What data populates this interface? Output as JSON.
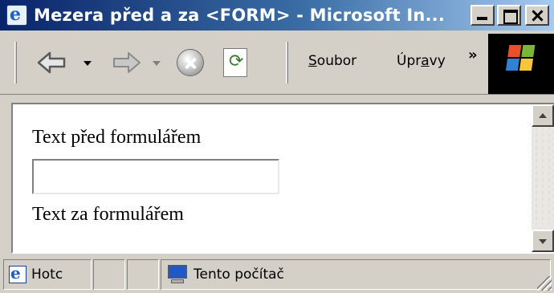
{
  "window": {
    "title": "Mezera před a za <FORM> - Microsoft In...",
    "icon": "ie-page-icon"
  },
  "toolbar": {
    "menu": [
      {
        "label": "Soubor"
      },
      {
        "label": "Úpravy"
      }
    ],
    "more_glyph": "»",
    "buttons": [
      "back-icon",
      "forward-icon",
      "stop-icon",
      "refresh-icon"
    ]
  },
  "page": {
    "text_before": "Text před formulářem",
    "input_value": "",
    "text_after": "Text za formulářem"
  },
  "statusbar": {
    "status_text": "Hotc",
    "zone_text": "Tento počítač"
  }
}
